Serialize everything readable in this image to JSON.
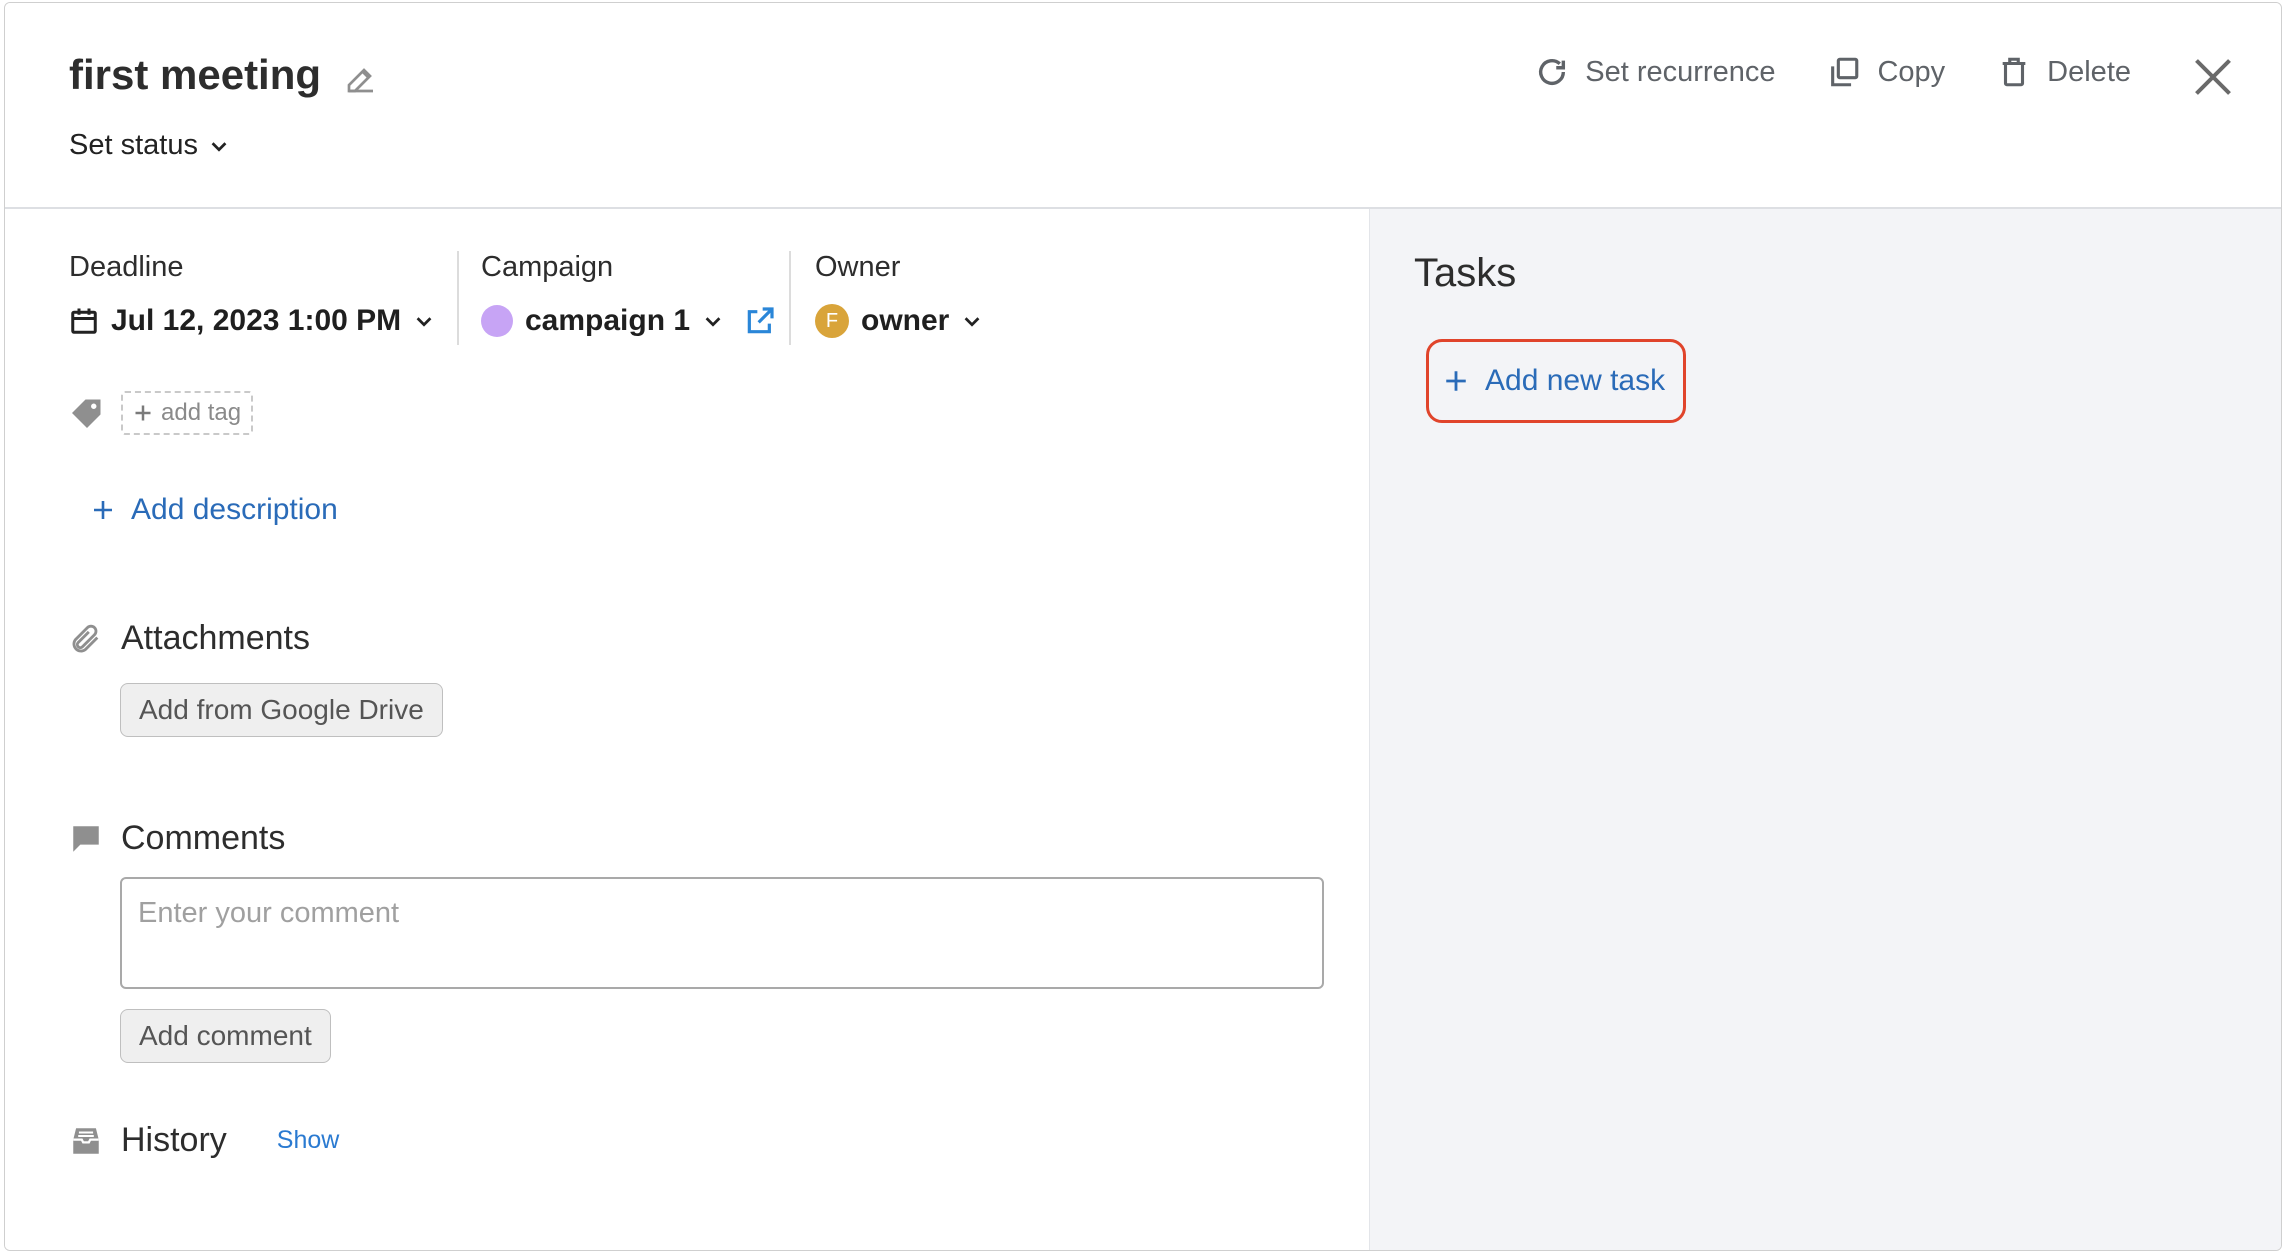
{
  "header": {
    "title": "first meeting",
    "status_label": "Set status",
    "actions": {
      "recurrence": "Set recurrence",
      "copy": "Copy",
      "delete": "Delete"
    }
  },
  "fields": {
    "deadline": {
      "label": "Deadline",
      "value": "Jul 12, 2023 1:00 PM"
    },
    "campaign": {
      "label": "Campaign",
      "value": "campaign 1",
      "color": "#c7a4f5"
    },
    "owner": {
      "label": "Owner",
      "value": "owner",
      "avatar_letter": "F",
      "avatar_color": "#d9a43a"
    }
  },
  "tags": {
    "add_label": "add tag"
  },
  "description": {
    "add_label": "Add description"
  },
  "attachments": {
    "title": "Attachments",
    "google_drive_button": "Add from Google Drive"
  },
  "comments": {
    "title": "Comments",
    "placeholder": "Enter your comment",
    "button": "Add comment"
  },
  "history": {
    "title": "History",
    "show_link": "Show"
  },
  "tasks": {
    "title": "Tasks",
    "add_label": "Add new task",
    "highlight_color": "#e0442b"
  },
  "colors": {
    "link": "#2a6bb8",
    "panel_bg": "#f3f4f7"
  }
}
